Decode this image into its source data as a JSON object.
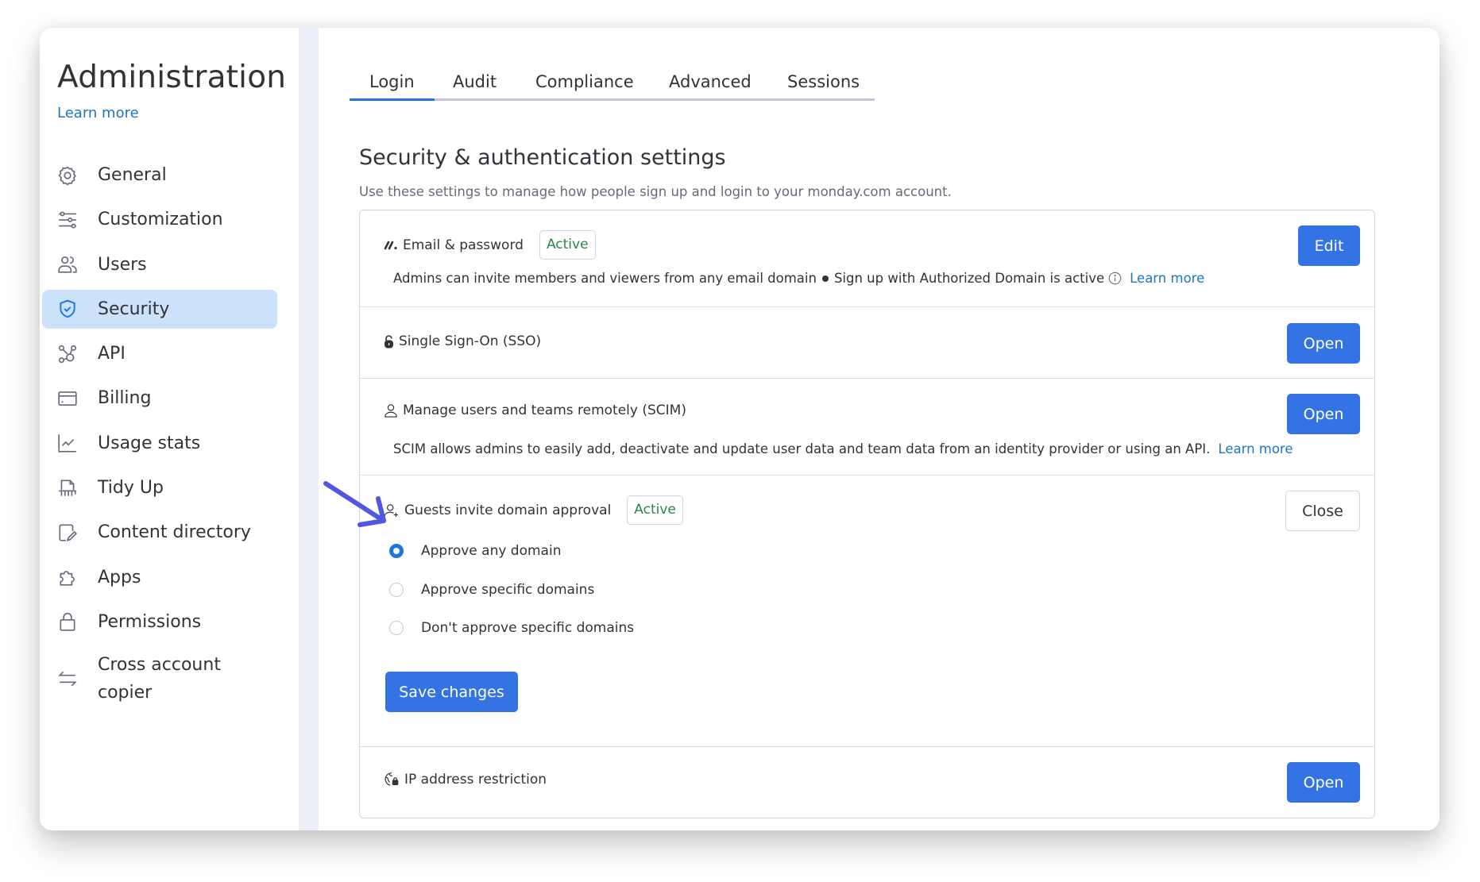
{
  "sidebar": {
    "title": "Administration",
    "learn_more": "Learn more",
    "items": [
      {
        "label": "General",
        "icon": "gear-icon"
      },
      {
        "label": "Customization",
        "icon": "sliders-icon"
      },
      {
        "label": "Users",
        "icon": "users-icon"
      },
      {
        "label": "Security",
        "icon": "shield-check-icon",
        "active": true
      },
      {
        "label": "API",
        "icon": "api-nodes-icon"
      },
      {
        "label": "Billing",
        "icon": "credit-card-icon"
      },
      {
        "label": "Usage stats",
        "icon": "line-chart-icon"
      },
      {
        "label": "Tidy Up",
        "icon": "shredder-icon"
      },
      {
        "label": "Content directory",
        "icon": "document-edit-icon"
      },
      {
        "label": "Apps",
        "icon": "puzzle-icon"
      },
      {
        "label": "Permissions",
        "icon": "lock-icon"
      },
      {
        "label": "Cross account copier",
        "icon": "swap-arrows-icon"
      }
    ]
  },
  "tabs": [
    {
      "label": "Login",
      "active": true
    },
    {
      "label": "Audit"
    },
    {
      "label": "Compliance"
    },
    {
      "label": "Advanced"
    },
    {
      "label": "Sessions"
    }
  ],
  "main": {
    "heading": "Security & authentication settings",
    "subtext": "Use these settings to manage how people sign up and login to your monday.com account."
  },
  "sections": {
    "email": {
      "title": "Email & password",
      "badge": "Active",
      "desc_part1": "Admins can invite members and viewers from any email domain",
      "desc_part2": "Sign up with Authorized Domain is active",
      "learn_more": "Learn more",
      "button": "Edit"
    },
    "sso": {
      "title": "Single Sign-On (SSO)",
      "button": "Open"
    },
    "scim": {
      "title": "Manage users and teams remotely (SCIM)",
      "desc": "SCIM allows admins to easily add, deactivate and update user data and team data from an identity provider or using an API.",
      "learn_more": "Learn more",
      "button": "Open"
    },
    "guests": {
      "title": "Guests invite domain approval",
      "badge": "Active",
      "button": "Close",
      "options": [
        {
          "label": "Approve any domain",
          "selected": true
        },
        {
          "label": "Approve specific domains",
          "selected": false
        },
        {
          "label": "Don't approve specific domains",
          "selected": false
        }
      ],
      "save_label": "Save changes"
    },
    "ip": {
      "title": "IP address restriction",
      "button": "Open"
    }
  },
  "colors": {
    "accent": "#3373e4",
    "active_badge": "#258750",
    "link": "#1f76c2",
    "sidebar_active": "#cce1fa",
    "annotation_arrow": "#5157e0"
  }
}
